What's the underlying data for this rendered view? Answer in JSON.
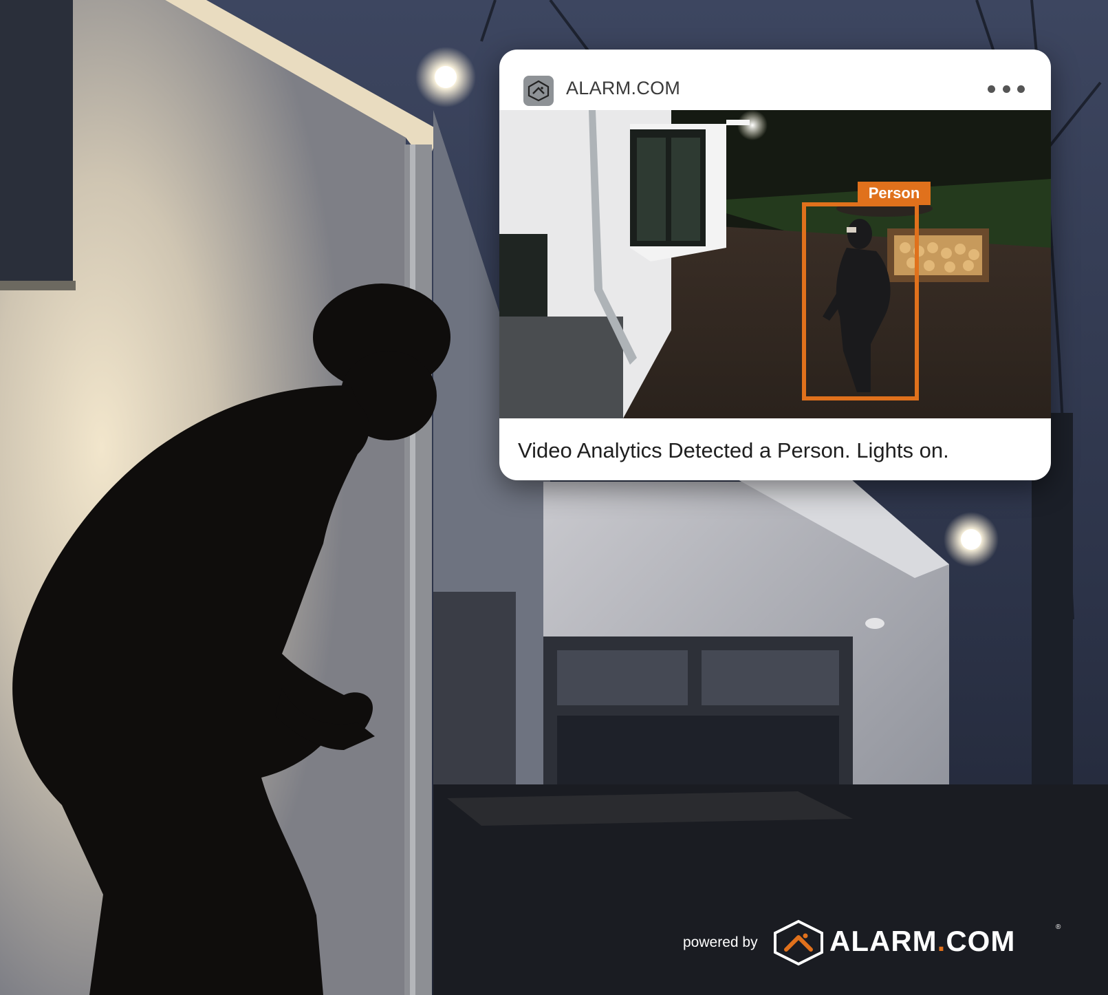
{
  "notification": {
    "app_name": "ALARM.COM",
    "app_icon": "alarm-com-house-icon",
    "more_icon": "more-horizontal-icon",
    "detection_label": "Person",
    "message": "Video Analytics Detected a Person. Lights on."
  },
  "branding": {
    "powered_by": "powered by",
    "wordmark_main": "ALARM",
    "wordmark_dot": ".",
    "wordmark_suffix": "COM",
    "registered_mark": "®"
  },
  "colors": {
    "accent": "#e0711c",
    "card_background": "#ffffff",
    "text": "#1f1f1f"
  }
}
